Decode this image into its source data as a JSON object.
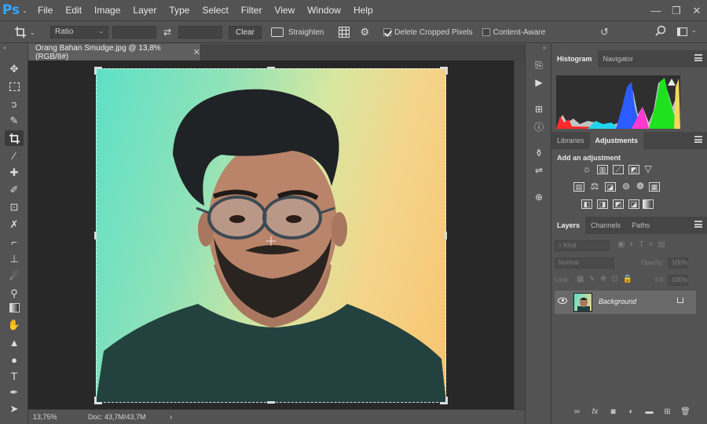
{
  "app": {
    "logo": "Ps"
  },
  "menu": [
    "File",
    "Edit",
    "Image",
    "Layer",
    "Type",
    "Select",
    "Filter",
    "View",
    "Window",
    "Help"
  ],
  "options": {
    "ratio_label": "Ratio",
    "clear_label": "Clear",
    "straighten_label": "Straighten",
    "delete_cropped_label": "Delete Cropped Pixels",
    "delete_cropped_checked": true,
    "content_aware_label": "Content-Aware",
    "content_aware_checked": false
  },
  "document": {
    "tab_title": "Orang Bahan Smudge.jpg @ 13,8% (RGB/8#)",
    "zoom": "13,75%",
    "doc_info": "Doc: 43,7M/43,7M"
  },
  "panels": {
    "top_tabs": [
      "Histogram",
      "Navigator"
    ],
    "mid_tabs": [
      "Libraries",
      "Adjustments"
    ],
    "adjustment_title": "Add an adjustment",
    "layer_tabs": [
      "Layers",
      "Channels",
      "Paths"
    ],
    "kind_placeholder": "Kind",
    "blend_mode": "Normal",
    "opacity_label": "Opacity:",
    "opacity_value": "100%",
    "lock_label": "Lock:",
    "fill_label": "Fill:",
    "fill_value": "100%",
    "layer_name": "Background"
  },
  "colors": {
    "accent": "#31a8ff",
    "panel": "#535353",
    "canvas": "#282828"
  }
}
